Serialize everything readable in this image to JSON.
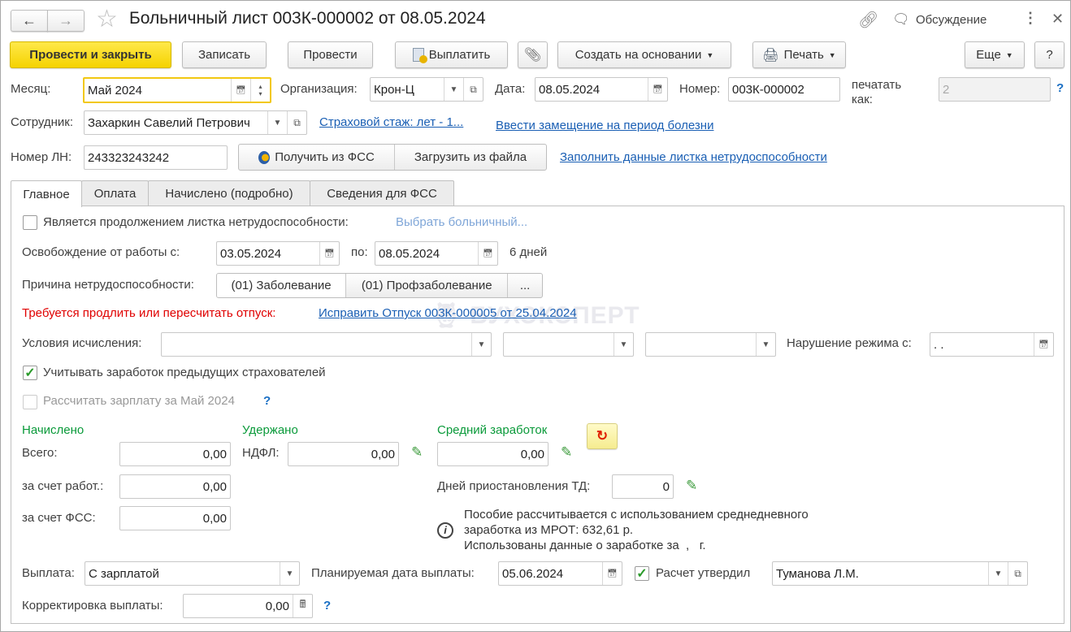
{
  "window": {
    "title": "Больничный лист 003К-000002 от 08.05.2024",
    "discuss_label": "Обсуждение"
  },
  "toolbar": {
    "post_close": "Провести и закрыть",
    "save": "Записать",
    "post": "Провести",
    "pay": "Выплатить",
    "create_based": "Создать на основании",
    "print": "Печать",
    "more": "Еще",
    "help": "?"
  },
  "header": {
    "month_label": "Месяц:",
    "month_value": "Май 2024",
    "org_label": "Организация:",
    "org_value": "Крон-Ц",
    "date_label": "Дата:",
    "date_value": "08.05.2024",
    "number_label": "Номер:",
    "number_value": "003К-000002",
    "print_as_label_1": "печатать",
    "print_as_label_2": "как:",
    "print_as_value": "2",
    "help": "?",
    "employee_label": "Сотрудник:",
    "employee_value": "Захаркин Савелий Петрович",
    "insurance_link": "Страховой стаж: лет - 1...",
    "substitute_link": "Ввести замещение на период болезни",
    "ln_label": "Номер ЛН:",
    "ln_value": "243323243242",
    "get_fss": "Получить из ФСС",
    "load_file": "Загрузить из файла",
    "fill_link": "Заполнить данные листка нетрудоспособности"
  },
  "tabs": [
    {
      "label": "Главное",
      "active": true
    },
    {
      "label": "Оплата"
    },
    {
      "label": "Начислено (подробно)"
    },
    {
      "label": "Сведения для ФСС"
    }
  ],
  "main": {
    "continuation_label": "Является продолжением листка нетрудоспособности:",
    "continuation_checked": false,
    "choose_link": "Выбрать больничный...",
    "release_label": "Освобождение от работы с:",
    "release_from": "03.05.2024",
    "to_label": "по:",
    "release_to": "08.05.2024",
    "days": "6 дней",
    "reason_label": "Причина нетрудоспособности:",
    "reason_1": "(01) Заболевание",
    "reason_2": "(01) Профзаболевание",
    "reason_more": "...",
    "warning": "Требуется продлить или пересчитать отпуск:",
    "fix_link": "Исправить Отпуск 003К-000005 от 25.04.2024",
    "watermark": "БУХЭКСПЕРТ",
    "conditions_label": "Условия исчисления:",
    "conditions_1": "",
    "conditions_2": "",
    "conditions_3": "",
    "violation_label": "Нарушение режима с:",
    "violation_value": " .  .",
    "prev_insurers_label": "Учитывать заработок предыдущих страхователей",
    "prev_insurers_checked": true,
    "calc_salary_label": "Рассчитать зарплату за Май 2024",
    "calc_salary_checked": false,
    "help": "?",
    "accrued_title": "Начислено",
    "withheld_title": "Удержано",
    "avg_title": "Средний заработок",
    "total_label": "Всего:",
    "total_value": "0,00",
    "ndfl_label": "НДФЛ:",
    "ndfl_value": "0,00",
    "avg_value": "0,00",
    "employer_label": "за счет работ.:",
    "employer_value": "0,00",
    "fss_label": "за счет ФСС:",
    "fss_value": "0,00",
    "suspend_label": "Дней приостановления ТД:",
    "suspend_value": "0",
    "info_1": "Пособие рассчитывается с использованием среднедневного",
    "info_2": "заработка из МРОТ: 632,61 р.",
    "info_3": "Использованы данные о заработке за  ,   г.",
    "payment_label": "Выплата:",
    "payment_value": "С зарплатой",
    "planned_label": "Планируемая дата выплаты:",
    "planned_value": "05.06.2024",
    "approved_label": "Расчет утвердил",
    "approved_checked": true,
    "approved_value": "Туманова Л.М.",
    "correction_label": "Корректировка выплаты:",
    "correction_value": "0,00",
    "help2": "?"
  },
  "colors": {
    "accent_yellow": "#f5d300",
    "link": "#1a5fb4",
    "green": "#0a9a3a",
    "warning": "#e00000"
  }
}
